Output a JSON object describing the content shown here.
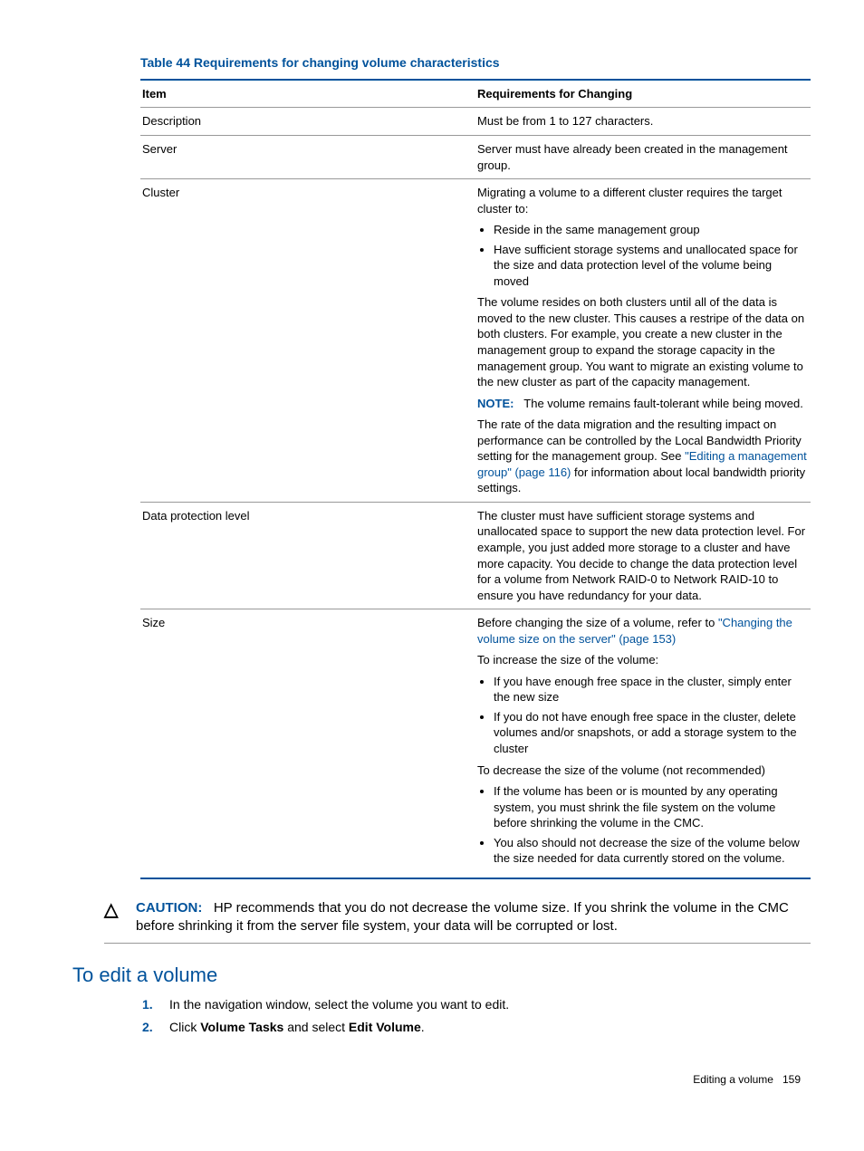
{
  "table": {
    "caption": "Table 44 Requirements for changing volume characteristics",
    "headers": {
      "item": "Item",
      "req": "Requirements for Changing"
    },
    "rows": {
      "description": {
        "item": "Description",
        "req": "Must be from 1 to 127 characters."
      },
      "server": {
        "item": "Server",
        "req": "Server must have already been created in the management group."
      },
      "cluster": {
        "item": "Cluster",
        "p1": "Migrating a volume to a different cluster requires the target cluster to:",
        "b1": "Reside in the same management group",
        "b2": "Have sufficient storage systems and unallocated space for the size and data protection level of the volume being moved",
        "p2": "The volume resides on both clusters until all of the data is moved to the new cluster. This causes a restripe of the data on both clusters. For example, you create a new cluster in the management group to expand the storage capacity in the management group. You want to migrate an existing volume to the new cluster as part of the capacity management.",
        "note_label": "NOTE:",
        "note_text": "The volume remains fault-tolerant while being moved.",
        "p3_a": "The rate of the data migration and the resulting impact on performance can be controlled by the Local Bandwidth Priority setting for the management group. See ",
        "p3_link": "\"Editing a management group\" (page 116)",
        "p3_b": " for information about local bandwidth priority settings."
      },
      "dpl": {
        "item": "Data protection level",
        "req": "The cluster must have sufficient storage systems and unallocated space to support the new data protection level. For example, you just added more storage to a cluster and have more capacity. You decide to change the data protection level for a volume from Network RAID-0 to Network RAID-10 to ensure you have redundancy for your data."
      },
      "size": {
        "item": "Size",
        "p1_a": "Before changing the size of a volume, refer to ",
        "p1_link": "\"Changing the volume size on the server\" (page 153)",
        "p2": "To increase the size of the volume:",
        "b1": "If you have enough free space in the cluster, simply enter the new size",
        "b2": "If you do not have enough free space in the cluster, delete volumes and/or snapshots, or add a storage system to the cluster",
        "p3": "To decrease the size of the volume (not recommended)",
        "b3": "If the volume has been or is mounted by any operating system, you must shrink the file system on the volume before shrinking the volume in the CMC.",
        "b4": "You also should not decrease the size of the volume below the size needed for data currently stored on the volume."
      }
    }
  },
  "caution": {
    "label": "CAUTION:",
    "text": "HP recommends that you do not decrease the volume size. If you shrink the volume in the CMC before shrinking it from the server file system, your data will be corrupted or lost."
  },
  "section_heading": "To edit a volume",
  "steps": {
    "s1": "In the navigation window, select the volume you want to edit.",
    "s2_a": "Click ",
    "s2_b": "Volume Tasks",
    "s2_c": " and select ",
    "s2_d": "Edit Volume",
    "s2_e": "."
  },
  "footer": {
    "section": "Editing a volume",
    "page": "159"
  }
}
